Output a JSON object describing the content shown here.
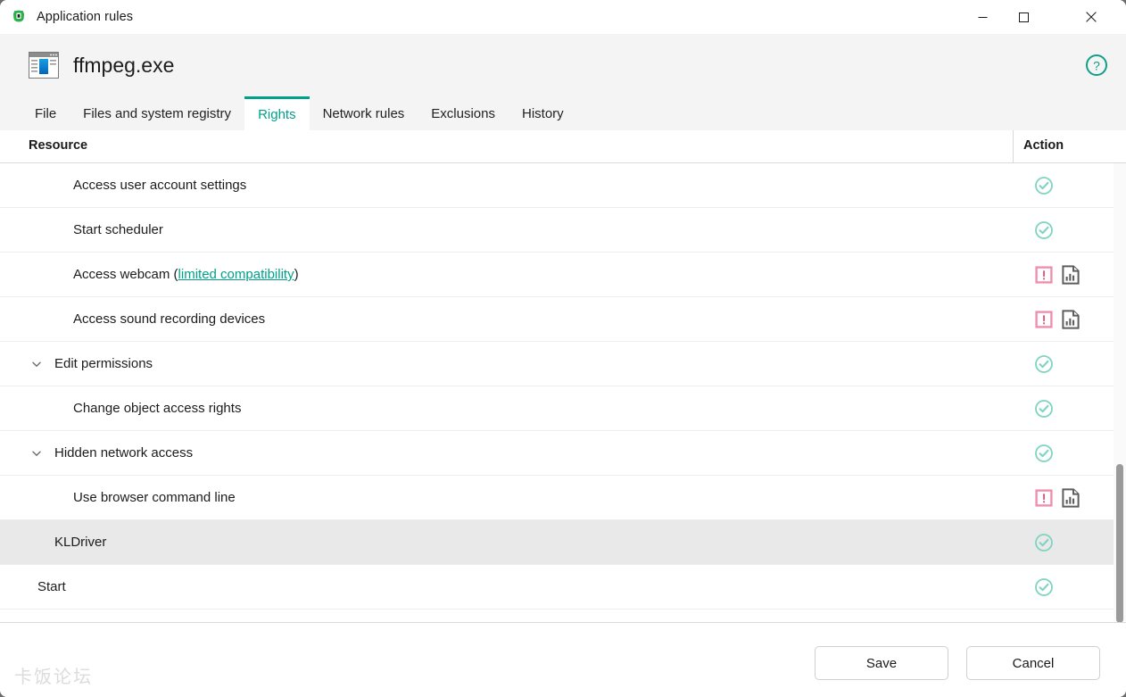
{
  "window": {
    "title": "Application rules",
    "titlebar_icon": "kaspersky-shield-icon",
    "controls": {
      "minimize": "minimize-icon",
      "maximize": "maximize-icon",
      "close": "close-icon"
    }
  },
  "header": {
    "app_icon": "application-window-icon",
    "app_name": "ffmpeg.exe",
    "help_icon": "help-circle-icon"
  },
  "tabs": [
    {
      "label": "File",
      "active": false
    },
    {
      "label": "Files and system registry",
      "active": false
    },
    {
      "label": "Rights",
      "active": true
    },
    {
      "label": "Network rules",
      "active": false
    },
    {
      "label": "Exclusions",
      "active": false
    },
    {
      "label": "History",
      "active": false
    }
  ],
  "table": {
    "columns": {
      "resource": "Resource",
      "action": "Action"
    },
    "rows": [
      {
        "label": "Access user account settings",
        "label_suffix": "",
        "link": "",
        "indent": 2,
        "chevron": false,
        "selected": false,
        "actions": [
          "allow-check-icon"
        ]
      },
      {
        "label": "Start scheduler",
        "label_suffix": "",
        "link": "",
        "indent": 2,
        "chevron": false,
        "selected": false,
        "actions": [
          "allow-check-icon"
        ]
      },
      {
        "label": "Access webcam (",
        "link": "limited compatibility",
        "label_suffix": ")",
        "indent": 2,
        "chevron": false,
        "selected": false,
        "actions": [
          "prompt-warning-icon",
          "report-chart-icon"
        ]
      },
      {
        "label": "Access sound recording devices",
        "label_suffix": "",
        "link": "",
        "indent": 2,
        "chevron": false,
        "selected": false,
        "actions": [
          "prompt-warning-icon",
          "report-chart-icon"
        ]
      },
      {
        "label": "Edit permissions",
        "label_suffix": "",
        "link": "",
        "indent": 1,
        "chevron": true,
        "selected": false,
        "actions": [
          "allow-check-icon"
        ]
      },
      {
        "label": "Change object access rights",
        "label_suffix": "",
        "link": "",
        "indent": 2,
        "chevron": false,
        "selected": false,
        "actions": [
          "allow-check-icon"
        ]
      },
      {
        "label": "Hidden network access",
        "label_suffix": "",
        "link": "",
        "indent": 1,
        "chevron": true,
        "selected": false,
        "actions": [
          "allow-check-icon"
        ]
      },
      {
        "label": "Use browser command line",
        "label_suffix": "",
        "link": "",
        "indent": 2,
        "chevron": false,
        "selected": false,
        "actions": [
          "prompt-warning-icon",
          "report-chart-icon"
        ]
      },
      {
        "label": "KLDriver",
        "label_suffix": "",
        "link": "",
        "indent": 1,
        "chevron": false,
        "selected": true,
        "actions": [
          "allow-check-icon"
        ]
      },
      {
        "label": "Start",
        "label_suffix": "",
        "link": "",
        "indent": 0,
        "chevron": false,
        "selected": false,
        "actions": [
          "allow-check-icon"
        ]
      }
    ]
  },
  "footer": {
    "save_label": "Save",
    "cancel_label": "Cancel"
  },
  "watermark": "卡饭论坛",
  "colors": {
    "accent": "#00a18a",
    "allow": "#7fd4c1",
    "warn_border": "#f08fad",
    "warn_glyph": "#e8547c",
    "report": "#5e5e5e",
    "header_bg": "#f4f4f4",
    "selected_row": "#e9e9e9"
  }
}
